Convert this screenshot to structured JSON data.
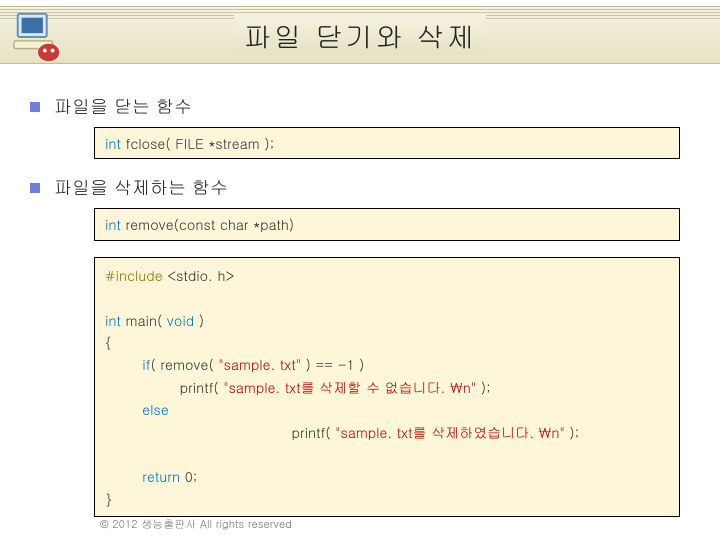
{
  "title": "파일 닫기와 삭제",
  "bullets": {
    "b1": "파일을 닫는 함수",
    "b2": "파일을 삭제하는 함수"
  },
  "code": {
    "fclose_type": "int",
    "fclose_rest": " fclose( FILE *stream );",
    "remove_type": "int",
    "remove_rest": " remove(const char *path)",
    "inc1": "#include",
    "inc2": " <stdio. h>",
    "main_int": "int",
    "main_sig1": " main( ",
    "main_void": "void",
    "main_sig2": " )",
    "lbrace": "{",
    "if_kw": "        if",
    "if_cond1": "( remove( ",
    "str1": "\"sample. txt\"",
    "if_cond2": " ) == -1 )",
    "pf1a": "                printf( ",
    "pf1s": "\"sample. txt를 삭제할 수 없습니다. \\n\"",
    "pf1b": " );",
    "else_kw": "        else",
    "pf2a": "                                        printf( ",
    "pf2s": "\"sample. txt를 삭제하였습니다. \\n\"",
    "pf2b": " );",
    "ret_kw": "        return",
    "ret_rest": " 0;",
    "rbrace": "}"
  },
  "footer": "© 2012 생능출판사 All rights reserved"
}
